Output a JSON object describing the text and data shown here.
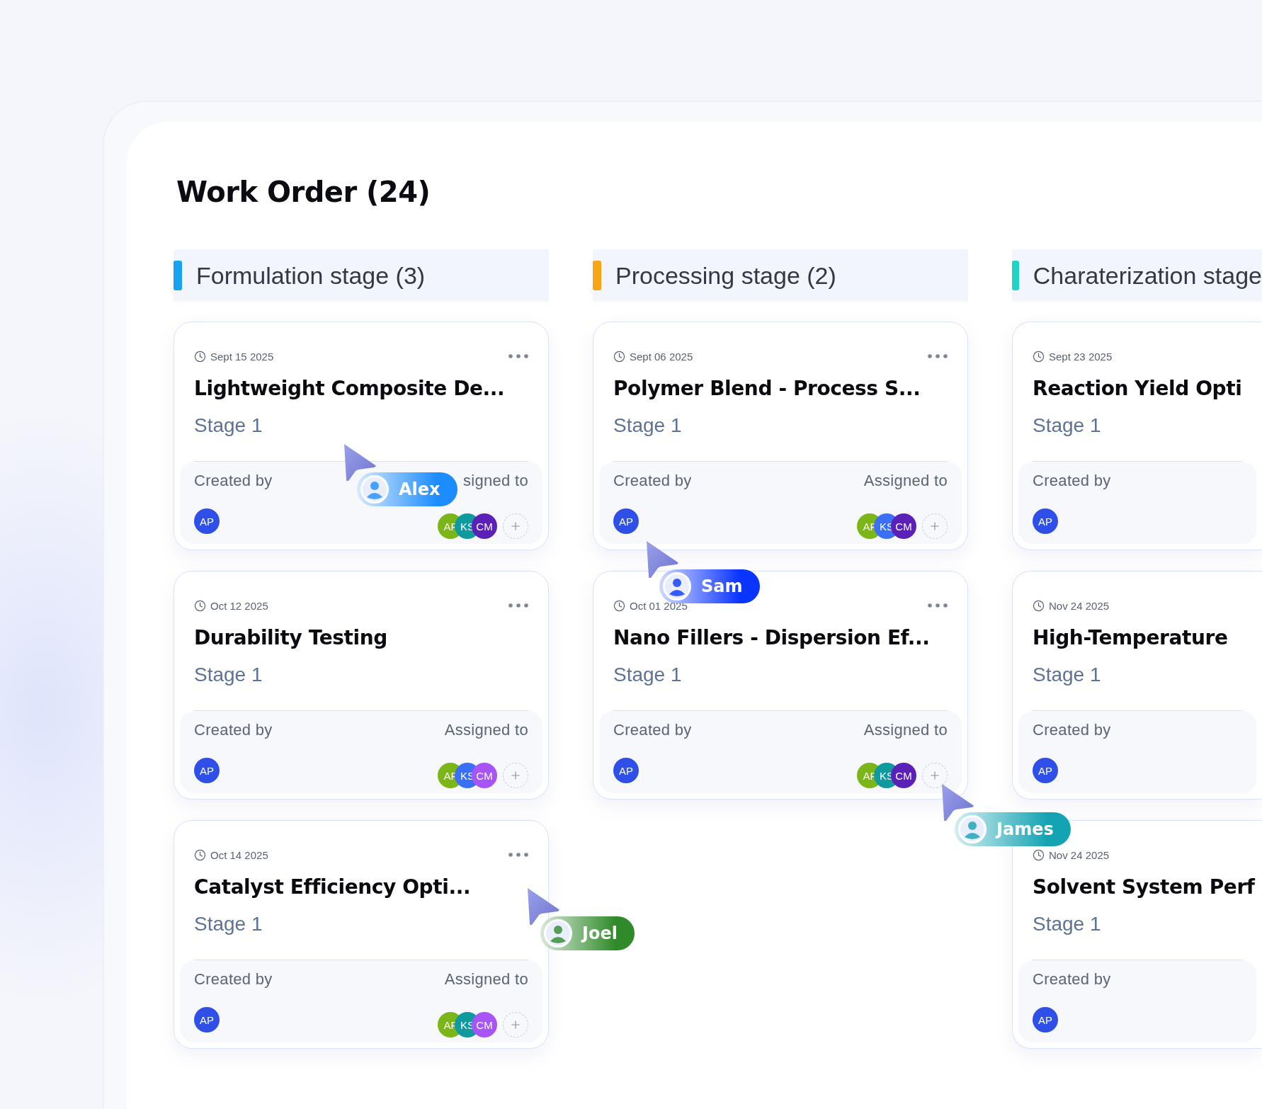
{
  "title": "Work Order (24)",
  "columns": [
    {
      "title": "Formulation stage (3)",
      "color": "#17a2f2",
      "cards": [
        {
          "date": "Sept 15 2025",
          "title": "Lightweight Composite De...",
          "stage": "Stage 1",
          "created_label": "Created by",
          "creator": "AP",
          "assigned_label": "signed to",
          "assignees": [
            {
              "initials": "AF",
              "color": "#7cb518"
            },
            {
              "initials": "KS",
              "color": "#10999f"
            },
            {
              "initials": "CM",
              "color": "#5b21b6"
            }
          ]
        },
        {
          "date": "Oct 12 2025",
          "title": "Durability Testing",
          "stage": "Stage 1",
          "created_label": "Created by",
          "creator": "AP",
          "assigned_label": "Assigned to",
          "assignees": [
            {
              "initials": "AF",
              "color": "#7cb518"
            },
            {
              "initials": "KS",
              "color": "#3b6ff5"
            },
            {
              "initials": "CM",
              "color": "#a855f7"
            }
          ]
        },
        {
          "date": "Oct 14 2025",
          "title": "Catalyst Efficiency Opti...",
          "stage": "Stage 1",
          "created_label": "Created by",
          "creator": "AP",
          "assigned_label": "Assigned to",
          "assignees": [
            {
              "initials": "AF",
              "color": "#7cb518"
            },
            {
              "initials": "KS",
              "color": "#10999f"
            },
            {
              "initials": "CM",
              "color": "#a855f7"
            }
          ]
        }
      ]
    },
    {
      "title": "Processing stage (2)",
      "color": "#f7a516",
      "cards": [
        {
          "date": "Sept 06 2025",
          "title": "Polymer Blend - Process S...",
          "stage": "Stage 1",
          "created_label": "Created by",
          "creator": "AP",
          "assigned_label": "Assigned to",
          "assignees": [
            {
              "initials": "AF",
              "color": "#7cb518"
            },
            {
              "initials": "KS",
              "color": "#3b6ff5"
            },
            {
              "initials": "CM",
              "color": "#5b21b6"
            }
          ]
        },
        {
          "date": "Oct 01 2025",
          "title": "Nano Fillers - Dispersion Ef...",
          "stage": "Stage 1",
          "created_label": "Created by",
          "creator": "AP",
          "assigned_label": "Assigned to",
          "assignees": [
            {
              "initials": "AF",
              "color": "#7cb518"
            },
            {
              "initials": "KS",
              "color": "#10999f"
            },
            {
              "initials": "CM",
              "color": "#5b21b6"
            }
          ]
        }
      ]
    },
    {
      "title": "Charaterization stage",
      "color": "#1fd3c6",
      "cards": [
        {
          "date": "Sept 23 2025",
          "title": "Reaction Yield Opti",
          "stage": "Stage 1",
          "created_label": "Created by",
          "creator": "AP"
        },
        {
          "date": "Nov 24 2025",
          "title": "High-Temperature",
          "stage": "Stage 1",
          "created_label": "Created by",
          "creator": "AP"
        },
        {
          "date": "Nov 24 2025",
          "title": "Solvent System Perf",
          "stage": "Stage 1",
          "created_label": "Created by",
          "creator": "AP"
        }
      ]
    }
  ],
  "cursors": [
    {
      "name": "Alex",
      "color": "#1c8cff"
    },
    {
      "name": "Sam",
      "color": "#0a34ff"
    },
    {
      "name": "James",
      "color": "#14a3b3"
    },
    {
      "name": "Joel",
      "color": "#2f8a2a"
    }
  ]
}
